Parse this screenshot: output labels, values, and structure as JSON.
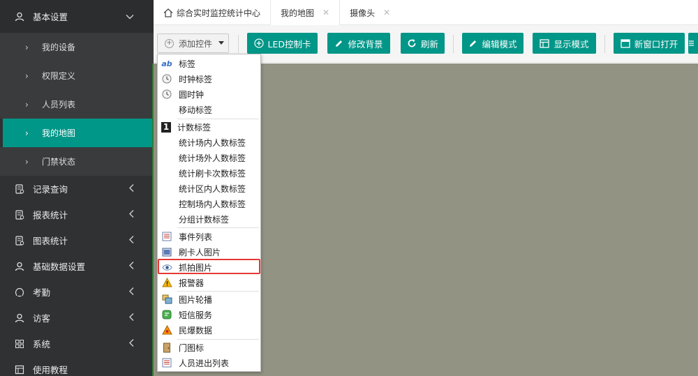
{
  "sidebar": {
    "group_top": {
      "label": "基本设置"
    },
    "sub_items": [
      {
        "label": "我的设备"
      },
      {
        "label": "权限定义"
      },
      {
        "label": "人员列表"
      },
      {
        "label": "我的地图"
      },
      {
        "label": "门禁状态"
      }
    ],
    "groups": [
      {
        "label": "记录查询",
        "icon": "record-icon"
      },
      {
        "label": "报表统计",
        "icon": "report-icon"
      },
      {
        "label": "图表统计",
        "icon": "chart-icon"
      },
      {
        "label": "基础数据设置",
        "icon": "user-icon"
      },
      {
        "label": "考勤",
        "icon": "attendance-icon"
      },
      {
        "label": "访客",
        "icon": "visitor-icon"
      },
      {
        "label": "系统",
        "icon": "grid-icon"
      },
      {
        "label": "使用教程",
        "icon": "tutorial-icon"
      }
    ],
    "accent": "#009688"
  },
  "tabs": [
    {
      "label": "综合实时监控统计中心",
      "icon": "home-icon"
    },
    {
      "label": "我的地图",
      "close": "✕"
    },
    {
      "label": "摄像头",
      "close": "✕"
    }
  ],
  "toolbar": {
    "add_label": "添加控件",
    "buttons": [
      {
        "label": "LED控制卡",
        "icon": "plus-circle-icon"
      },
      {
        "label": "修改背景",
        "icon": "pencil-icon"
      },
      {
        "label": "刷新",
        "icon": "refresh-icon"
      },
      {
        "label": "编辑模式",
        "icon": "pencil-icon"
      },
      {
        "label": "显示模式",
        "icon": "table-icon"
      },
      {
        "label": "新窗口打开",
        "icon": "window-icon"
      }
    ]
  },
  "menu": {
    "items": [
      {
        "label": "标签",
        "icon": "ab-icon"
      },
      {
        "label": "时钟标签",
        "icon": "clock-icon"
      },
      {
        "label": "圆时钟",
        "icon": "clock-icon"
      },
      {
        "label": "移动标签",
        "icon": ""
      },
      {
        "label": "计数标签",
        "icon": "counter-icon"
      },
      {
        "label": "统计场内人数标签",
        "icon": ""
      },
      {
        "label": "统计场外人数标签",
        "icon": ""
      },
      {
        "label": "统计刷卡次数标签",
        "icon": ""
      },
      {
        "label": "统计区内人数标签",
        "icon": ""
      },
      {
        "label": "控制场内人数标签",
        "icon": ""
      },
      {
        "label": "分组计数标签",
        "icon": ""
      },
      {
        "label": "事件列表",
        "icon": "list-icon"
      },
      {
        "label": "刷卡人图片",
        "icon": "picture-icon"
      },
      {
        "label": "抓拍图片",
        "icon": "eye-icon"
      },
      {
        "label": "报警器",
        "icon": "warning-icon"
      },
      {
        "label": "图片轮播",
        "icon": "slides-icon"
      },
      {
        "label": "短信服务",
        "icon": "sms-icon"
      },
      {
        "label": "民爆数据",
        "icon": "hazard-icon"
      },
      {
        "label": "门图标",
        "icon": "door-icon"
      },
      {
        "label": "人员进出列表",
        "icon": "list-icon"
      }
    ],
    "highlighted": "抓拍图片",
    "highlight_color": "#e53935"
  }
}
